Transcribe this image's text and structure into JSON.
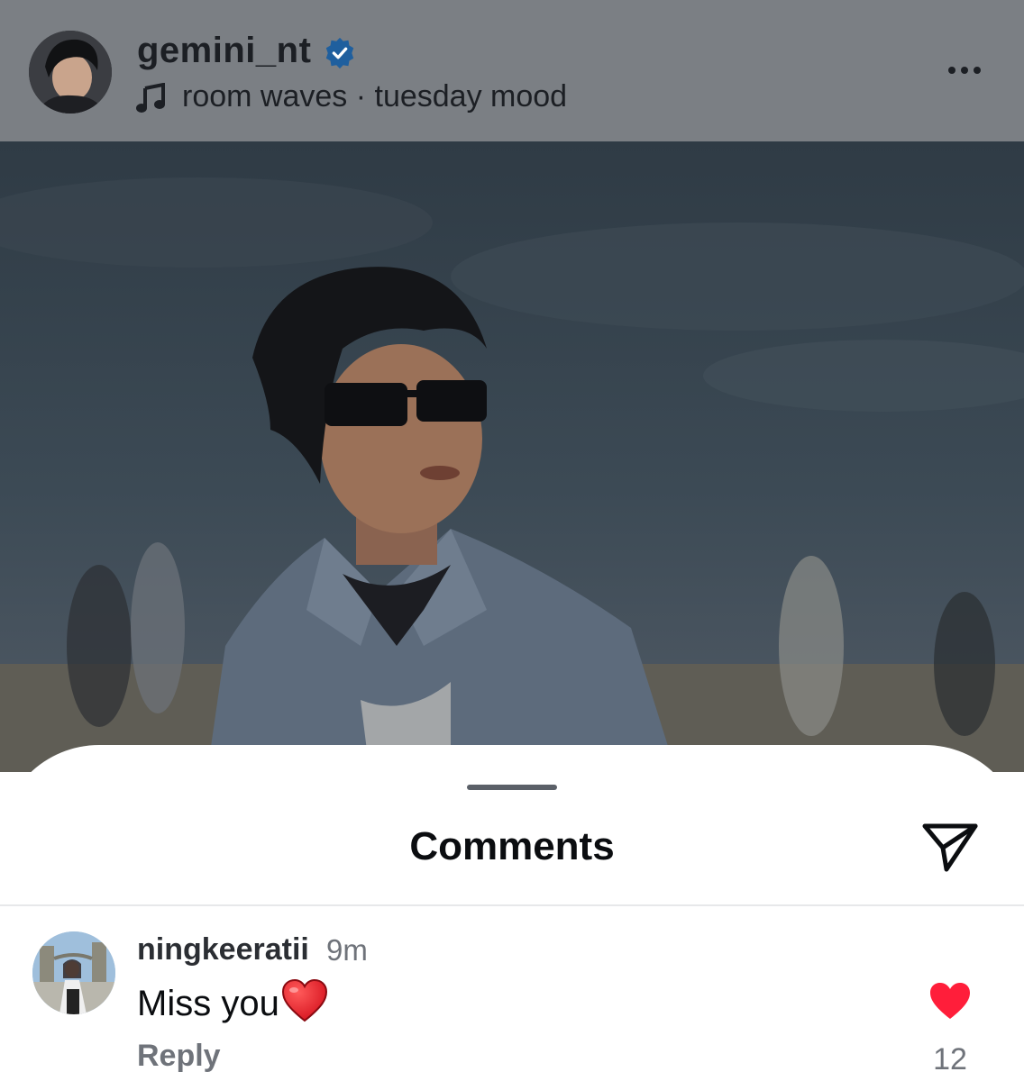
{
  "post_header": {
    "username": "gemini_nt",
    "audio": "room waves · tuesday mood"
  },
  "comments_sheet": {
    "title": "Comments",
    "comments": [
      {
        "username": "ningkeeratii",
        "time": "9m",
        "text": "Miss you",
        "reply_label": "Reply",
        "like_count": "12"
      }
    ]
  },
  "colors": {
    "verified": "#2f7fd6",
    "like": "#ff1e3a",
    "header_dim": "#7b7f84"
  }
}
